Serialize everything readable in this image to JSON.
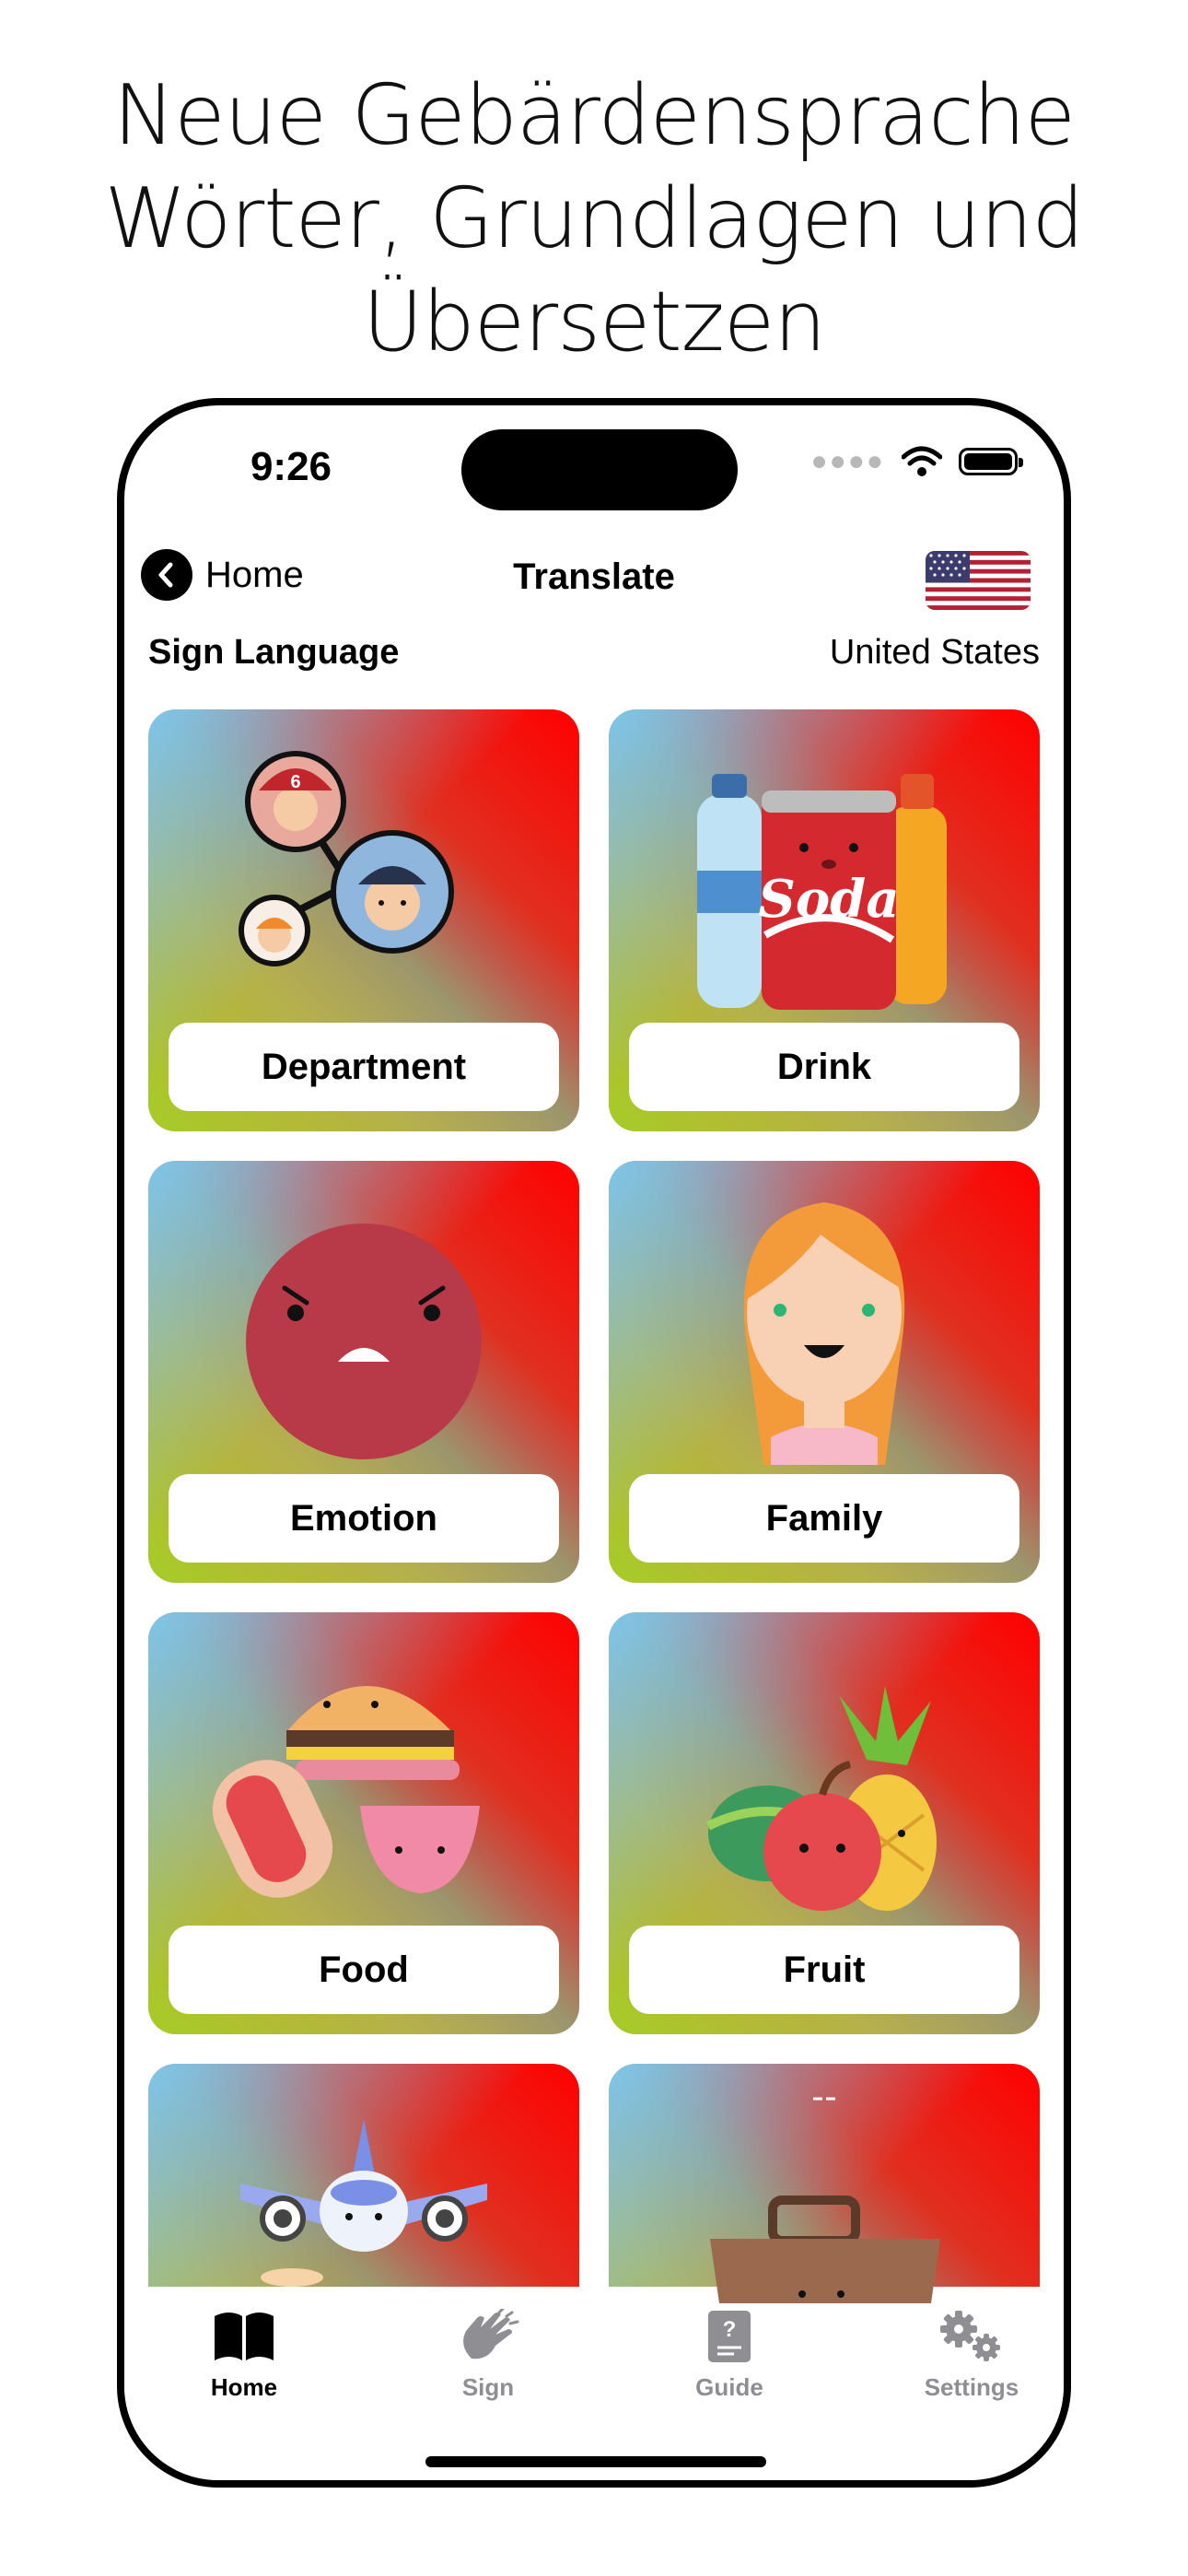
{
  "promo": {
    "line1": "Neue Gebärdensprache",
    "line2": "Wörter, Grundlagen und",
    "line3": "Übersetzen"
  },
  "status_bar": {
    "time": "9:26"
  },
  "nav": {
    "back_label": "Home",
    "title": "Translate"
  },
  "subheader": {
    "left": "Sign Language",
    "right": "United States"
  },
  "categories": [
    {
      "label": "Department",
      "icon": "department-icon"
    },
    {
      "label": "Drink",
      "icon": "drink-icon"
    },
    {
      "label": "Emotion",
      "icon": "emotion-icon"
    },
    {
      "label": "Family",
      "icon": "family-icon"
    },
    {
      "label": "Food",
      "icon": "food-icon"
    },
    {
      "label": "Fruit",
      "icon": "fruit-icon"
    },
    {
      "label": "",
      "icon": "travel-icon"
    },
    {
      "label": "",
      "icon": "work-icon"
    }
  ],
  "drink_art_text": "Soda",
  "tabs": [
    {
      "label": "Home",
      "icon": "book-icon",
      "active": true
    },
    {
      "label": "Sign",
      "icon": "clap-icon",
      "active": false
    },
    {
      "label": "Guide",
      "icon": "guide-icon",
      "active": false
    },
    {
      "label": "Settings",
      "icon": "gear-icon",
      "active": false
    }
  ],
  "colors": {
    "accent": "#000000",
    "inactive_tab": "#8e8e93",
    "card_red": "#ff0000",
    "card_blue": "#7dc8f0",
    "card_green": "#a0d228",
    "card_orange": "#ee7b32"
  }
}
